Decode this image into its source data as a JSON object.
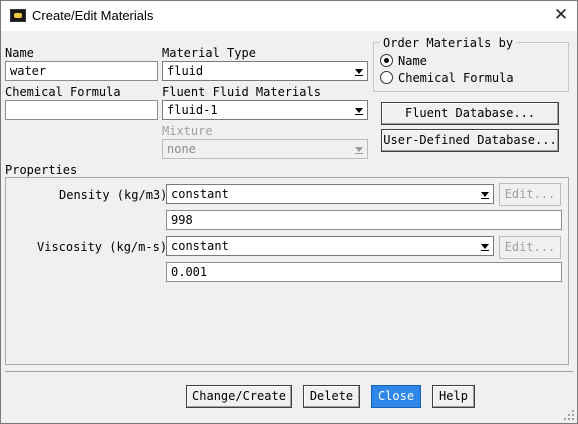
{
  "window": {
    "title": "Create/Edit Materials",
    "close_glyph": "✕"
  },
  "name": {
    "label": "Name",
    "value": "water"
  },
  "material_type": {
    "label": "Material Type",
    "value": "fluid"
  },
  "chemical_formula": {
    "label": "Chemical Formula",
    "value": ""
  },
  "fluent_fluid_materials": {
    "label": "Fluent Fluid Materials",
    "value": "fluid-1"
  },
  "mixture": {
    "label": "Mixture",
    "value": "none"
  },
  "order_by": {
    "title": "Order Materials by",
    "options": [
      {
        "label": "Name",
        "selected": true
      },
      {
        "label": "Chemical Formula",
        "selected": false
      }
    ]
  },
  "buttons": {
    "fluent_database": "Fluent Database...",
    "user_database": "User-Defined Database..."
  },
  "properties": {
    "title": "Properties",
    "density": {
      "label": "Density (kg/m3)",
      "method": "constant",
      "edit": "Edit...",
      "value": "998"
    },
    "viscosity": {
      "label": "Viscosity (kg/m-s)",
      "method": "constant",
      "edit": "Edit...",
      "value": "0.001"
    }
  },
  "footer": {
    "change_create": "Change/Create",
    "delete": "Delete",
    "close": "Close",
    "help": "Help"
  },
  "colors": {
    "accent": "#2e86e6",
    "background": "#f0f0f0"
  }
}
